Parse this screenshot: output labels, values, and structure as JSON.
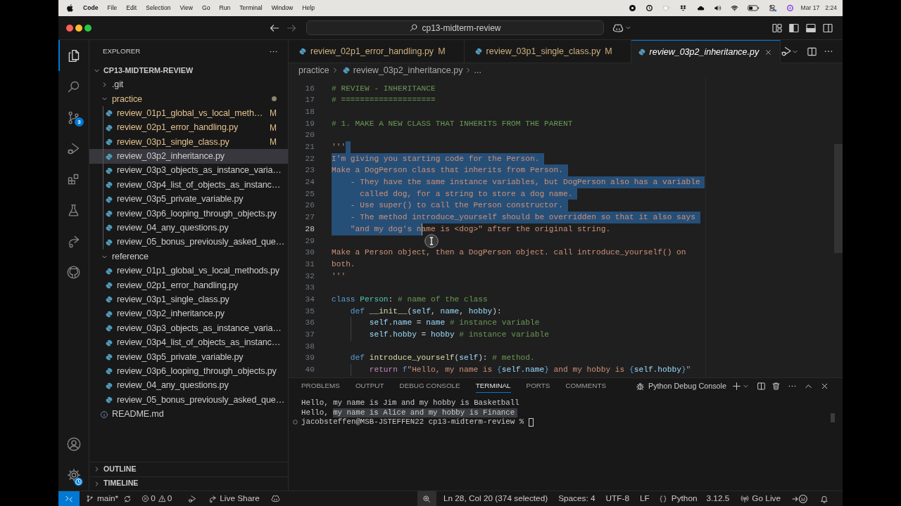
{
  "menu_bar": {
    "app_name": "Code",
    "menus": [
      "File",
      "Edit",
      "Selection",
      "View",
      "Go",
      "Run",
      "Terminal",
      "Window",
      "Help"
    ],
    "date": "Mar 17",
    "time": "2:24"
  },
  "title_bar": {
    "command_center": "cp13-midterm-review"
  },
  "activity_bar": {
    "items": [
      {
        "kind": "explorer",
        "selected": true
      },
      {
        "kind": "search",
        "selected": false
      },
      {
        "kind": "source_control",
        "selected": false,
        "badge": "3"
      },
      {
        "kind": "run_debug",
        "selected": false
      },
      {
        "kind": "extensions",
        "selected": false
      },
      {
        "kind": "testing",
        "selected": false
      },
      {
        "kind": "live_share",
        "selected": false
      },
      {
        "kind": "github",
        "selected": false
      }
    ]
  },
  "sidebar": {
    "title": "EXPLORER",
    "root": {
      "label": "CP13-MIDTERM-REVIEW",
      "expanded": true,
      "children": [
        {
          "label": ".git",
          "kind": "folder",
          "expanded": false,
          "selected": false,
          "modified": false
        },
        {
          "label": "practice",
          "kind": "folder",
          "expanded": true,
          "selected": false,
          "modified": true,
          "children": [
            {
              "label": "review_01p1_global_vs_local_meth…",
              "kind": "python",
              "selected": false,
              "modified": true,
              "git_status": "M"
            },
            {
              "label": "review_02p1_error_handling.py",
              "kind": "python",
              "selected": false,
              "modified": true,
              "git_status": "M"
            },
            {
              "label": "review_03p1_single_class.py",
              "kind": "python",
              "selected": false,
              "modified": true,
              "git_status": "M"
            },
            {
              "label": "review_03p2_inheritance.py",
              "kind": "python",
              "selected": true,
              "modified": false
            },
            {
              "label": "review_03p3_objects_as_instance_varia…",
              "kind": "python",
              "selected": false,
              "modified": false
            },
            {
              "label": "review_03p4_list_of_objects_as_instanc…",
              "kind": "python",
              "selected": false,
              "modified": false
            },
            {
              "label": "review_03p5_private_variable.py",
              "kind": "python",
              "selected": false,
              "modified": false
            },
            {
              "label": "review_03p6_looping_through_objects.py",
              "kind": "python",
              "selected": false,
              "modified": false
            },
            {
              "label": "review_04_any_questions.py",
              "kind": "python",
              "selected": false,
              "modified": false
            },
            {
              "label": "review_05_bonus_previously_asked_que…",
              "kind": "python",
              "selected": false,
              "modified": false
            }
          ]
        },
        {
          "label": "reference",
          "kind": "folder",
          "expanded": true,
          "selected": false,
          "modified": false,
          "children": [
            {
              "label": "review_01p1_global_vs_local_methods.py",
              "kind": "python",
              "selected": false,
              "modified": false
            },
            {
              "label": "review_02p1_error_handling.py",
              "kind": "python",
              "selected": false,
              "modified": false
            },
            {
              "label": "review_03p1_single_class.py",
              "kind": "python",
              "selected": false,
              "modified": false
            },
            {
              "label": "review_03p2_inheritance.py",
              "kind": "python",
              "selected": false,
              "modified": false
            },
            {
              "label": "review_03p3_objects_as_instance_varia…",
              "kind": "python",
              "selected": false,
              "modified": false
            },
            {
              "label": "review_03p4_list_of_objects_as_instanc…",
              "kind": "python",
              "selected": false,
              "modified": false
            },
            {
              "label": "review_03p5_private_variable.py",
              "kind": "python",
              "selected": false,
              "modified": false
            },
            {
              "label": "review_03p6_looping_through_objects.py",
              "kind": "python",
              "selected": false,
              "modified": false
            },
            {
              "label": "review_04_any_questions.py",
              "kind": "python",
              "selected": false,
              "modified": false
            },
            {
              "label": "review_05_bonus_previously_asked_que…",
              "kind": "python",
              "selected": false,
              "modified": false
            }
          ]
        },
        {
          "label": "README.md",
          "kind": "info",
          "selected": false,
          "modified": false
        }
      ]
    },
    "sections": [
      {
        "label": "OUTLINE",
        "expanded": false
      },
      {
        "label": "TIMELINE",
        "expanded": false
      }
    ]
  },
  "editor": {
    "tabs": [
      {
        "label": "review_02p1_error_handling.py",
        "git_status": "M",
        "modified": true,
        "selected": false,
        "preview": false
      },
      {
        "label": "review_03p1_single_class.py",
        "git_status": "M",
        "modified": true,
        "selected": false,
        "preview": false
      },
      {
        "label": "review_03p2_inheritance.py",
        "modified": false,
        "selected": true,
        "preview": true
      }
    ],
    "breadcrumbs": [
      {
        "label": "practice",
        "kind": "folder"
      },
      {
        "label": "review_03p2_inheritance.py",
        "kind": "python"
      },
      {
        "label": "...",
        "kind": "symbol"
      }
    ],
    "lines": [
      {
        "number": "16",
        "tokens": [
          {
            "text": "# REVIEW - INHERITANCE",
            "kind": "comment",
            "selected": false
          }
        ],
        "eol_selected": false,
        "current": false
      },
      {
        "number": "17",
        "tokens": [
          {
            "text": "# ====================",
            "kind": "comment",
            "selected": false
          }
        ],
        "eol_selected": false,
        "current": false
      },
      {
        "number": "18",
        "eol_selected": false,
        "current": false
      },
      {
        "number": "19",
        "tokens": [
          {
            "text": "# 1. MAKE A NEW CLASS THAT INHERITS FROM THE PARENT",
            "kind": "comment",
            "selected": false
          }
        ],
        "eol_selected": false,
        "current": false
      },
      {
        "number": "20",
        "eol_selected": false,
        "current": false
      },
      {
        "number": "21",
        "tokens": [
          {
            "text": "'''",
            "kind": "string",
            "selected": false
          }
        ],
        "eol_selected": true,
        "current": false
      },
      {
        "number": "22",
        "tokens": [
          {
            "text": "I'm giving you starting code for the Person.",
            "kind": "string",
            "selected": true
          }
        ],
        "eol_selected": true,
        "current": false
      },
      {
        "number": "23",
        "tokens": [
          {
            "text": "Make a DogPerson class that inherits from Person.",
            "kind": "string",
            "selected": true
          }
        ],
        "eol_selected": true,
        "current": false
      },
      {
        "number": "24",
        "tokens": [
          {
            "text": "    - They have the same instance variables, but DogPerson also has a variable",
            "kind": "string",
            "selected": true
          }
        ],
        "eol_selected": true,
        "current": false
      },
      {
        "number": "25",
        "tokens": [
          {
            "text": "      called dog, for a string to store a dog name.",
            "kind": "string",
            "selected": true
          }
        ],
        "eol_selected": true,
        "current": false
      },
      {
        "number": "26",
        "tokens": [
          {
            "text": "    - Use super() to call the Person constructor.",
            "kind": "string",
            "selected": true
          }
        ],
        "eol_selected": true,
        "current": false
      },
      {
        "number": "27",
        "tokens": [
          {
            "text": "    - The method introduce_yourself should be overridden so that it also says",
            "kind": "string",
            "selected": true
          }
        ],
        "eol_selected": true,
        "current": false
      },
      {
        "number": "28",
        "tokens": [
          {
            "text": "    \"and my dog's n",
            "kind": "string",
            "selected": true
          },
          {
            "text": "ame is <dog>\" after the original string.",
            "kind": "string",
            "selected": false
          }
        ],
        "eol_selected": false,
        "current": true
      },
      {
        "number": "29",
        "eol_selected": false,
        "current": false
      },
      {
        "number": "30",
        "tokens": [
          {
            "text": "Make a Person object, then a DogPerson object. call introduce_yourself() on",
            "kind": "string",
            "selected": false
          }
        ],
        "eol_selected": false,
        "current": false
      },
      {
        "number": "31",
        "tokens": [
          {
            "text": "both.",
            "kind": "string",
            "selected": false
          }
        ],
        "eol_selected": false,
        "current": false
      },
      {
        "number": "32",
        "tokens": [
          {
            "text": "'''",
            "kind": "string",
            "selected": false
          }
        ],
        "eol_selected": false,
        "current": false
      },
      {
        "number": "33",
        "eol_selected": false,
        "current": false
      },
      {
        "number": "34",
        "tokens": [
          {
            "text": "class ",
            "kind": "keyword",
            "selected": false
          },
          {
            "text": "Person",
            "kind": "class",
            "selected": false
          },
          {
            "text": ": ",
            "kind": "plain",
            "selected": false
          },
          {
            "text": "# name of the class",
            "kind": "comment",
            "selected": false
          }
        ],
        "eol_selected": false,
        "current": false
      },
      {
        "number": "35",
        "tokens": [
          {
            "text": "    def ",
            "kind": "keyword",
            "selected": false
          },
          {
            "text": "__init__",
            "kind": "function",
            "selected": false
          },
          {
            "text": "(",
            "kind": "plain",
            "selected": false
          },
          {
            "text": "self",
            "kind": "variable",
            "selected": false
          },
          {
            "text": ", ",
            "kind": "plain",
            "selected": false
          },
          {
            "text": "name",
            "kind": "variable",
            "selected": false
          },
          {
            "text": ", ",
            "kind": "plain",
            "selected": false
          },
          {
            "text": "hobby",
            "kind": "variable",
            "selected": false
          },
          {
            "text": "):",
            "kind": "plain",
            "selected": false
          }
        ],
        "eol_selected": false,
        "current": false
      },
      {
        "number": "36",
        "tokens": [
          {
            "text": "        self",
            "kind": "variable",
            "selected": false
          },
          {
            "text": ".",
            "kind": "plain",
            "selected": false
          },
          {
            "text": "name",
            "kind": "variable",
            "selected": false
          },
          {
            "text": " = ",
            "kind": "plain",
            "selected": false
          },
          {
            "text": "name",
            "kind": "variable",
            "selected": false
          },
          {
            "text": " # instance variable",
            "kind": "comment",
            "selected": false
          }
        ],
        "eol_selected": false,
        "current": false
      },
      {
        "number": "37",
        "tokens": [
          {
            "text": "        self",
            "kind": "variable",
            "selected": false
          },
          {
            "text": ".",
            "kind": "plain",
            "selected": false
          },
          {
            "text": "hobby",
            "kind": "variable",
            "selected": false
          },
          {
            "text": " = ",
            "kind": "plain",
            "selected": false
          },
          {
            "text": "hobby",
            "kind": "variable",
            "selected": false
          },
          {
            "text": " # instance variable",
            "kind": "comment",
            "selected": false
          }
        ],
        "eol_selected": false,
        "current": false
      },
      {
        "number": "38",
        "eol_selected": false,
        "current": false
      },
      {
        "number": "39",
        "tokens": [
          {
            "text": "    def ",
            "kind": "keyword",
            "selected": false
          },
          {
            "text": "introduce_yourself",
            "kind": "function",
            "selected": false
          },
          {
            "text": "(",
            "kind": "plain",
            "selected": false
          },
          {
            "text": "self",
            "kind": "variable",
            "selected": false
          },
          {
            "text": "): ",
            "kind": "plain",
            "selected": false
          },
          {
            "text": "# method.",
            "kind": "comment",
            "selected": false
          }
        ],
        "eol_selected": false,
        "current": false
      },
      {
        "number": "40",
        "tokens": [
          {
            "text": "        return ",
            "kind": "control",
            "selected": false
          },
          {
            "text": "f",
            "kind": "keyword",
            "selected": false
          },
          {
            "text": "\"Hello, my name is ",
            "kind": "string",
            "selected": false
          },
          {
            "text": "{",
            "kind": "keyword",
            "selected": false
          },
          {
            "text": "self.name",
            "kind": "variable",
            "selected": false
          },
          {
            "text": "}",
            "kind": "keyword",
            "selected": false
          },
          {
            "text": " and my hobby is ",
            "kind": "string",
            "selected": false
          },
          {
            "text": "{",
            "kind": "keyword",
            "selected": false
          },
          {
            "text": "self.hobby",
            "kind": "variable",
            "selected": false
          },
          {
            "text": "}",
            "kind": "keyword",
            "selected": false
          },
          {
            "text": "\"",
            "kind": "string",
            "selected": false
          }
        ],
        "eol_selected": false,
        "current": false
      }
    ]
  },
  "panel": {
    "tabs": [
      {
        "label": "PROBLEMS",
        "selected": false
      },
      {
        "label": "OUTPUT",
        "selected": false
      },
      {
        "label": "DEBUG CONSOLE",
        "selected": false
      },
      {
        "label": "TERMINAL",
        "selected": true
      },
      {
        "label": "PORTS",
        "selected": false
      },
      {
        "label": "COMMENTS",
        "selected": false
      }
    ],
    "terminal_title": "Python Debug Console",
    "terminal_lines": [
      {
        "kind": "output",
        "segments": [
          {
            "text": "Hello, my name is Jim and my hobby is Basketball",
            "selected": false
          }
        ]
      },
      {
        "kind": "output",
        "segments": [
          {
            "text": "Hello, ",
            "selected": false
          },
          {
            "text": "my name is Alice and my hobby is Finance",
            "selected": true
          }
        ]
      },
      {
        "kind": "prompt",
        "segments": [
          {
            "text": "jacobsteffen@MSB-JSTEFFEN22 cp13-midterm-review %",
            "selected": false
          }
        ]
      }
    ]
  },
  "status_bar": {
    "branch": "main*",
    "problems": {
      "errors": "0",
      "warnings": "0"
    },
    "live_share": "Live Share",
    "cursor_position": "Ln 28, Col 20 (374 selected)",
    "indentation": "Spaces: 4",
    "encoding": "UTF-8",
    "line_ending": "LF",
    "language": "Python",
    "interpreter": "3.12.5",
    "go_live": "Go Live"
  }
}
